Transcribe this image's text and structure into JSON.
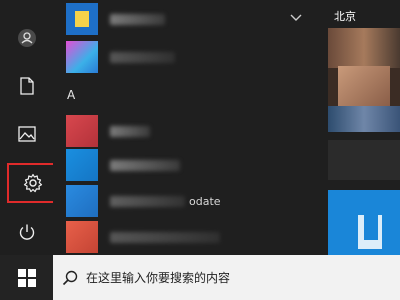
{
  "tiles": {
    "header_label": "北京"
  },
  "applist": {
    "section_letter": "A",
    "visible_fragment": "odate"
  },
  "search": {
    "placeholder": "在这里输入你要搜索的内容"
  },
  "rail": {
    "items": [
      {
        "icon": "user-icon"
      },
      {
        "icon": "document-icon"
      },
      {
        "icon": "pictures-icon"
      },
      {
        "icon": "gear-icon",
        "highlighted": true
      },
      {
        "icon": "power-icon"
      }
    ]
  },
  "colors": {
    "highlight_outline": "#e02b2b",
    "tile_blue": "#1a86d8",
    "taskbar": "#101010",
    "search_bg": "#f2f2f2"
  }
}
